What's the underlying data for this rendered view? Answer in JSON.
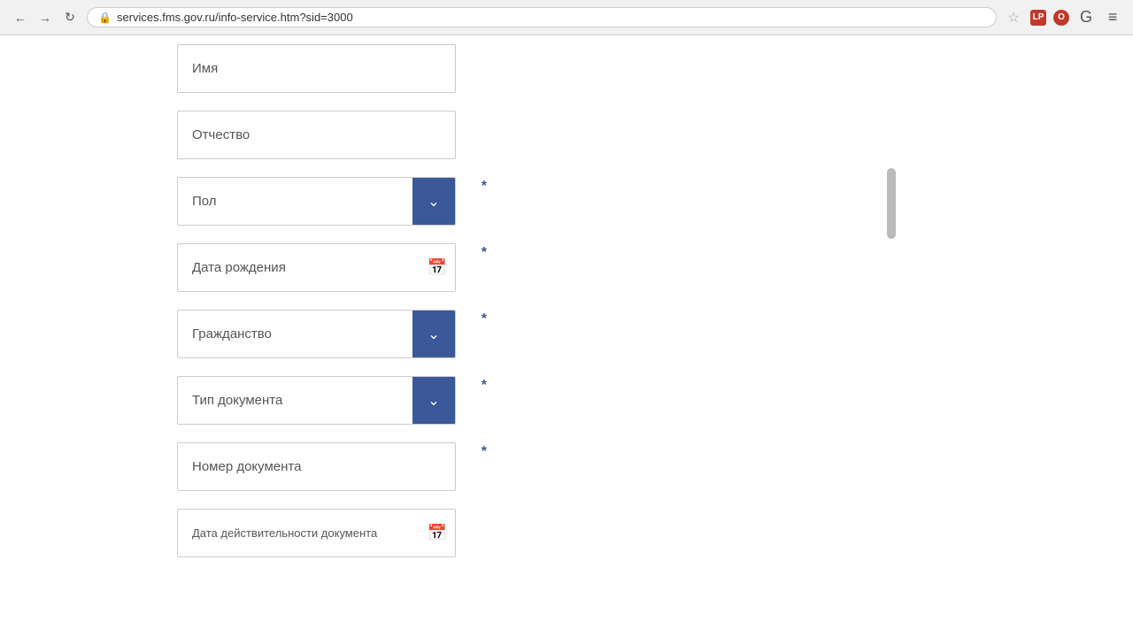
{
  "browser": {
    "url": "services.fms.gov.ru/info-service.htm?sid=3000",
    "back_label": "←",
    "forward_label": "→",
    "refresh_label": "↻",
    "star_label": "☆",
    "menu_label": "≡"
  },
  "form": {
    "fields": [
      {
        "id": "imya",
        "type": "text",
        "placeholder": "Имя",
        "required": false
      },
      {
        "id": "otchestvo",
        "type": "text",
        "placeholder": "Отчество",
        "required": false
      },
      {
        "id": "pol",
        "type": "select",
        "label": "Пол",
        "required": true
      },
      {
        "id": "data_rozhdeniya",
        "type": "date",
        "label": "Дата рождения",
        "required": true
      },
      {
        "id": "grazhdanstvo",
        "type": "select",
        "label": "Гражданство",
        "required": true
      },
      {
        "id": "tip_dokumenta",
        "type": "select",
        "label": "Тип документа",
        "required": true
      },
      {
        "id": "nomer_dokumenta",
        "type": "text",
        "placeholder": "Номер документа",
        "required": true
      },
      {
        "id": "data_deystvitelnosti",
        "type": "date",
        "label": "Дата действительности документа",
        "required": false
      }
    ]
  }
}
